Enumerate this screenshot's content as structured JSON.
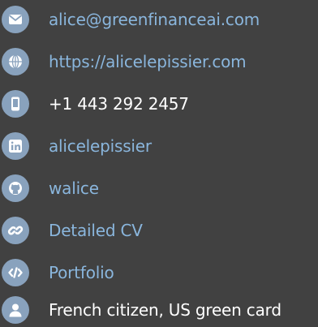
{
  "colors": {
    "background": "#414141",
    "icon_badge": "#89a2bd",
    "link_text": "#8ab6dd",
    "plain_text": "#ffffff"
  },
  "contacts": [
    {
      "icon": "envelope-icon",
      "text": "alice@greenfinanceai.com",
      "is_link": true
    },
    {
      "icon": "globe-icon",
      "text": "https://alicelepissier.com",
      "is_link": true
    },
    {
      "icon": "mobile-phone-icon",
      "text": "+1 443 292 2457",
      "is_link": false
    },
    {
      "icon": "linkedin-icon",
      "text": "alicelepissier",
      "is_link": true
    },
    {
      "icon": "github-icon",
      "text": "walice",
      "is_link": true
    },
    {
      "icon": "link-icon",
      "text": "Detailed CV",
      "is_link": true
    },
    {
      "icon": "code-icon",
      "text": "Portfolio",
      "is_link": true
    },
    {
      "icon": "user-icon",
      "text": "French citizen, US green card",
      "is_link": false
    }
  ]
}
